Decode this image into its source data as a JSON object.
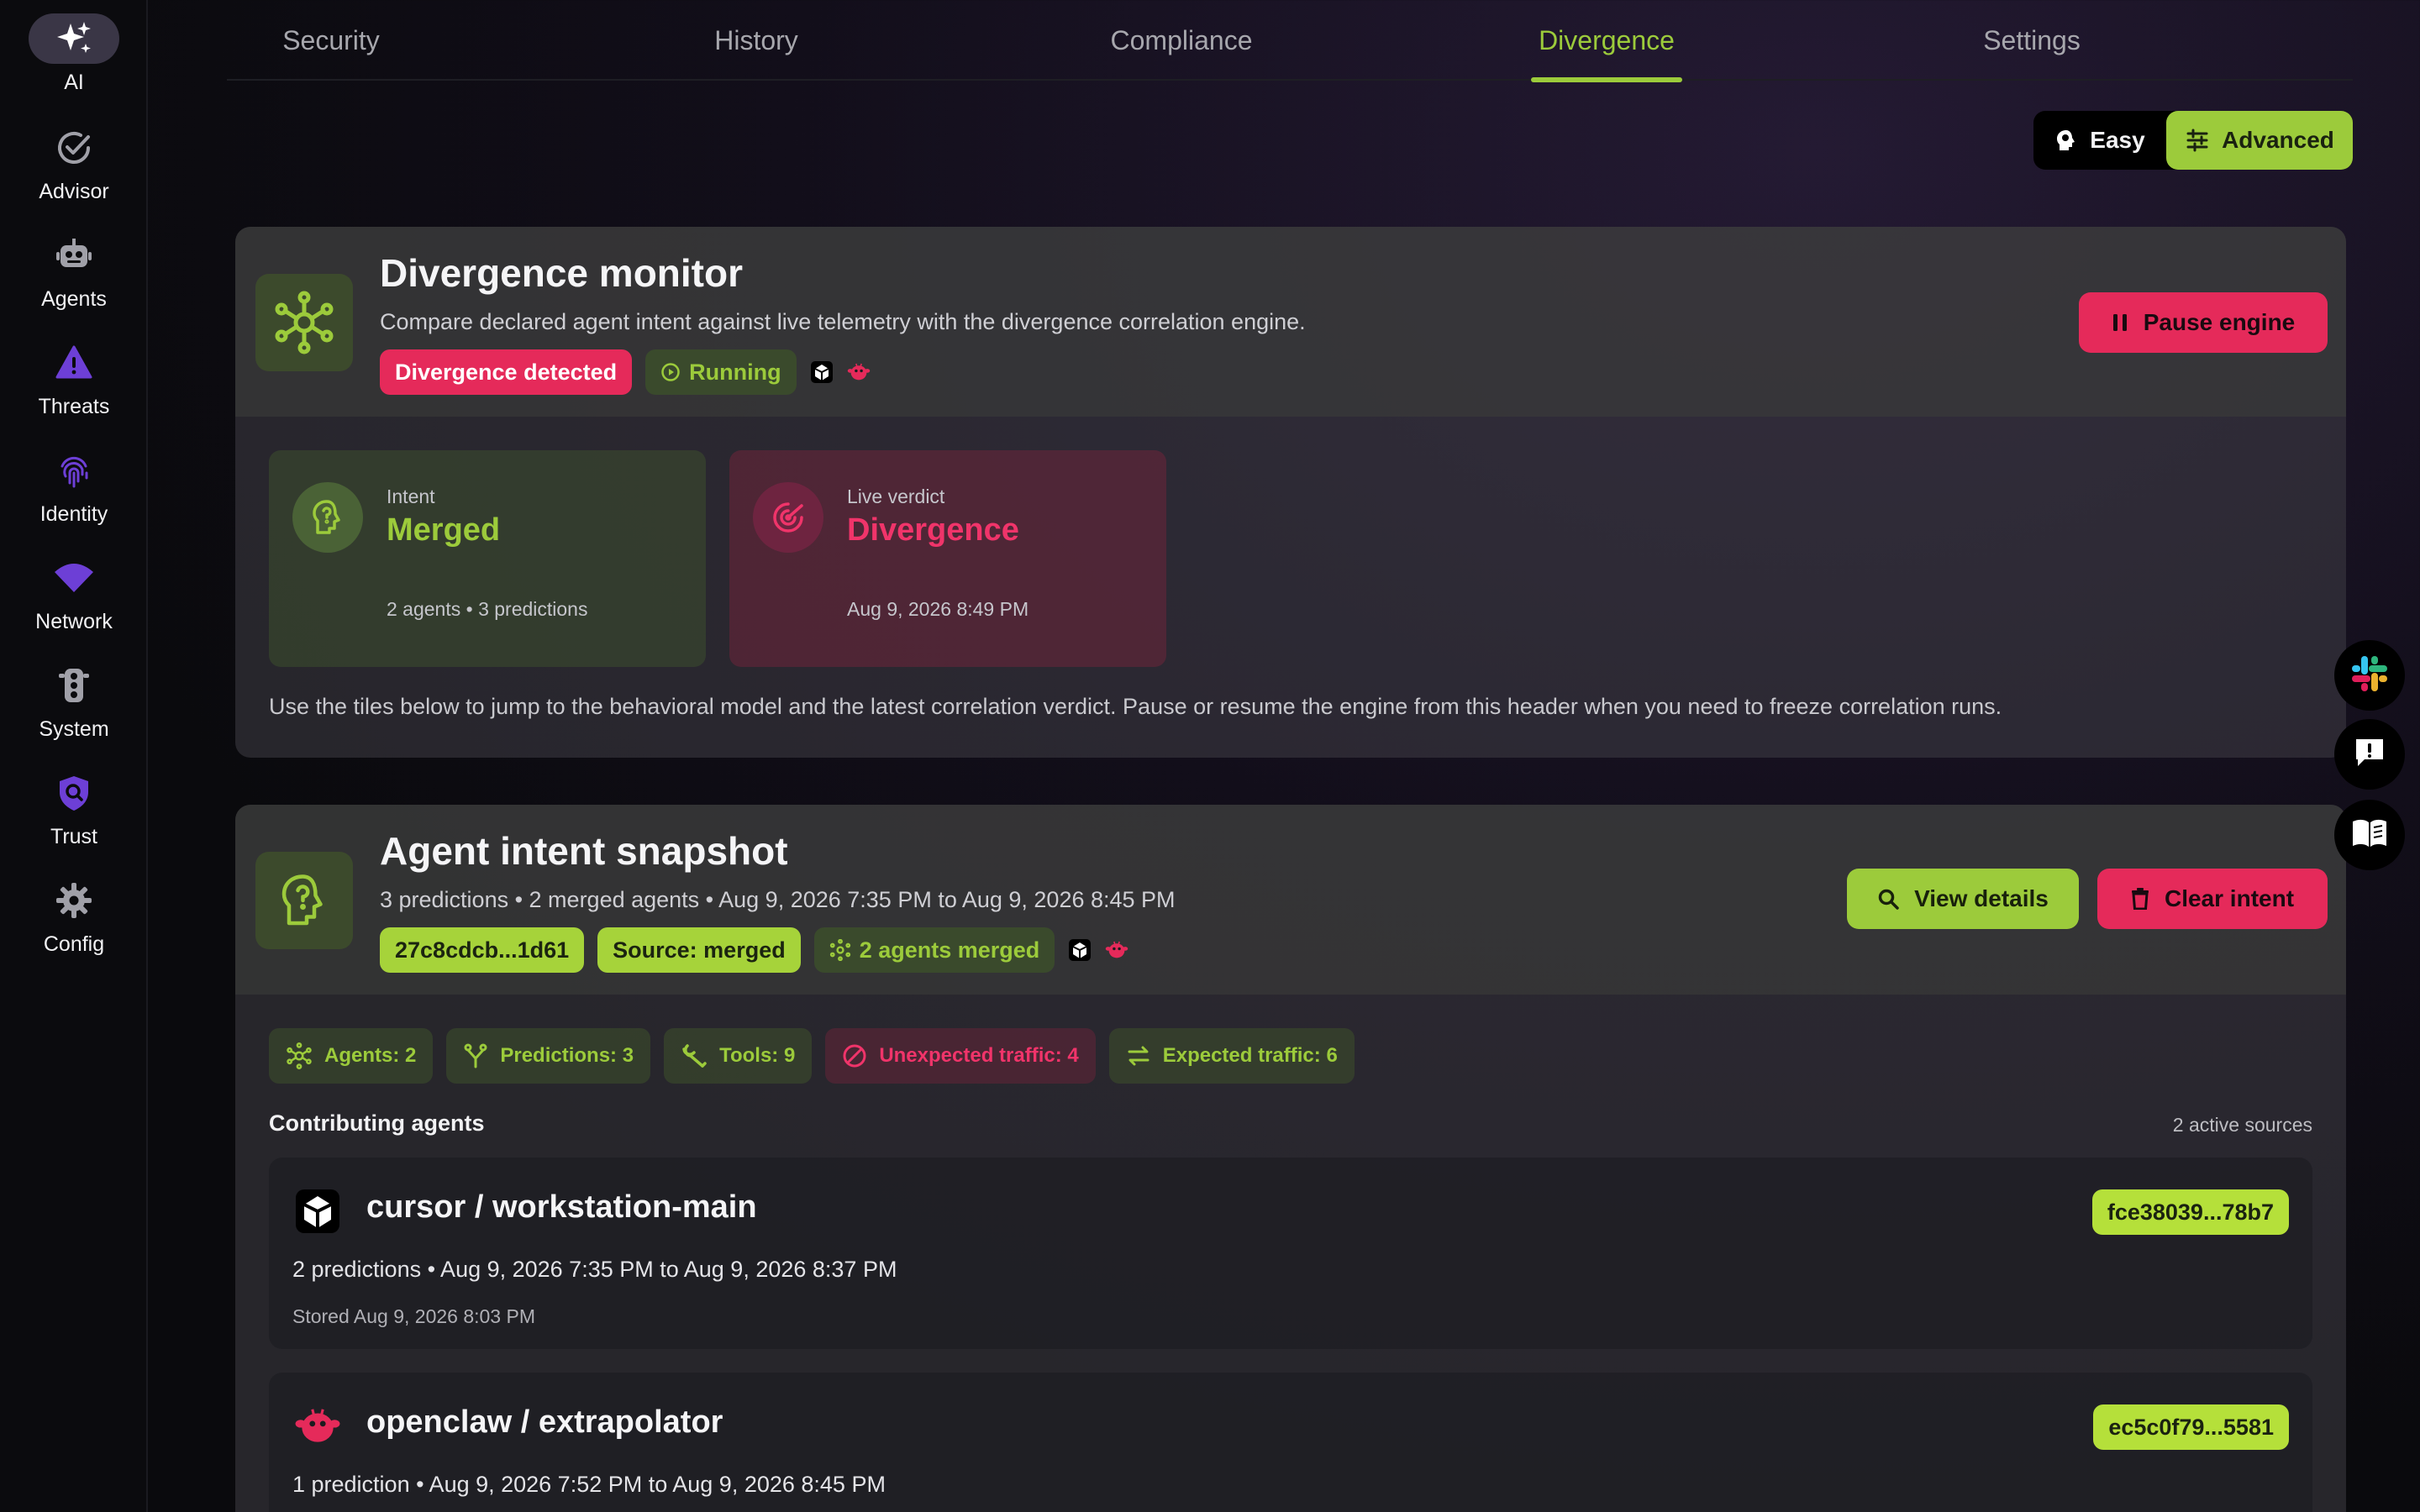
{
  "sidebar": {
    "items": [
      {
        "label": "AI",
        "icon": "sparkles-icon"
      },
      {
        "label": "Advisor",
        "icon": "check-circle-icon"
      },
      {
        "label": "Agents",
        "icon": "robot-icon"
      },
      {
        "label": "Threats",
        "icon": "warning-triangle-icon"
      },
      {
        "label": "Identity",
        "icon": "fingerprint-icon"
      },
      {
        "label": "Network",
        "icon": "wifi-icon"
      },
      {
        "label": "System",
        "icon": "traffic-light-icon"
      },
      {
        "label": "Trust",
        "icon": "shield-search-icon"
      },
      {
        "label": "Config",
        "icon": "gear-icon"
      }
    ]
  },
  "tabs": [
    {
      "label": "Security"
    },
    {
      "label": "History"
    },
    {
      "label": "Compliance"
    },
    {
      "label": "Divergence"
    },
    {
      "label": "Settings"
    }
  ],
  "active_tab": "Divergence",
  "mode": {
    "easy": "Easy",
    "advanced": "Advanced",
    "selected": "Advanced"
  },
  "monitor": {
    "title": "Divergence monitor",
    "subtitle": "Compare declared agent intent against live telemetry with the divergence correlation engine.",
    "badge_status": "Divergence detected",
    "badge_running": "Running",
    "pause_button": "Pause engine",
    "intent_tile": {
      "label": "Intent",
      "value": "Merged",
      "meta": "2 agents • 3 predictions"
    },
    "verdict_tile": {
      "label": "Live verdict",
      "value": "Divergence",
      "meta": "Aug 9, 2026 8:49 PM"
    },
    "hint": "Use the tiles below to jump to the behavioral model and the latest correlation verdict. Pause or resume the engine from this header when you need to freeze correlation runs."
  },
  "snapshot": {
    "title": "Agent intent snapshot",
    "subtitle": "3 predictions • 2 merged agents • Aug 9, 2026 7:35 PM to Aug 9, 2026 8:45 PM",
    "badge_hash": "27c8cdcb...1d61",
    "badge_source": "Source: merged",
    "badge_merged": "2 agents merged",
    "view_button": "View details",
    "clear_button": "Clear intent",
    "stats": {
      "agents": "Agents: 2",
      "predictions": "Predictions: 3",
      "tools": "Tools: 9",
      "unexpected": "Unexpected traffic: 4",
      "expected": "Expected traffic: 6"
    },
    "contrib_label": "Contributing agents",
    "active_sources": "2 active sources",
    "agents": [
      {
        "name": "cursor / workstation-main",
        "hash": "fce38039...78b7",
        "line": "2 predictions • Aug 9, 2026 7:35 PM to Aug 9, 2026 8:37 PM",
        "stored": "Stored Aug 9, 2026 8:03 PM"
      },
      {
        "name": "openclaw / extrapolator",
        "hash": "ec5c0f79...5581",
        "line": "1 prediction • Aug 9, 2026 7:52 PM to Aug 9, 2026 8:45 PM"
      }
    ]
  },
  "floating": [
    "slack-icon",
    "feedback-icon",
    "docs-book-icon"
  ],
  "colors": {
    "accent": "#9ccb3b",
    "danger": "#e52a5a",
    "background": "#0b0b0e"
  }
}
